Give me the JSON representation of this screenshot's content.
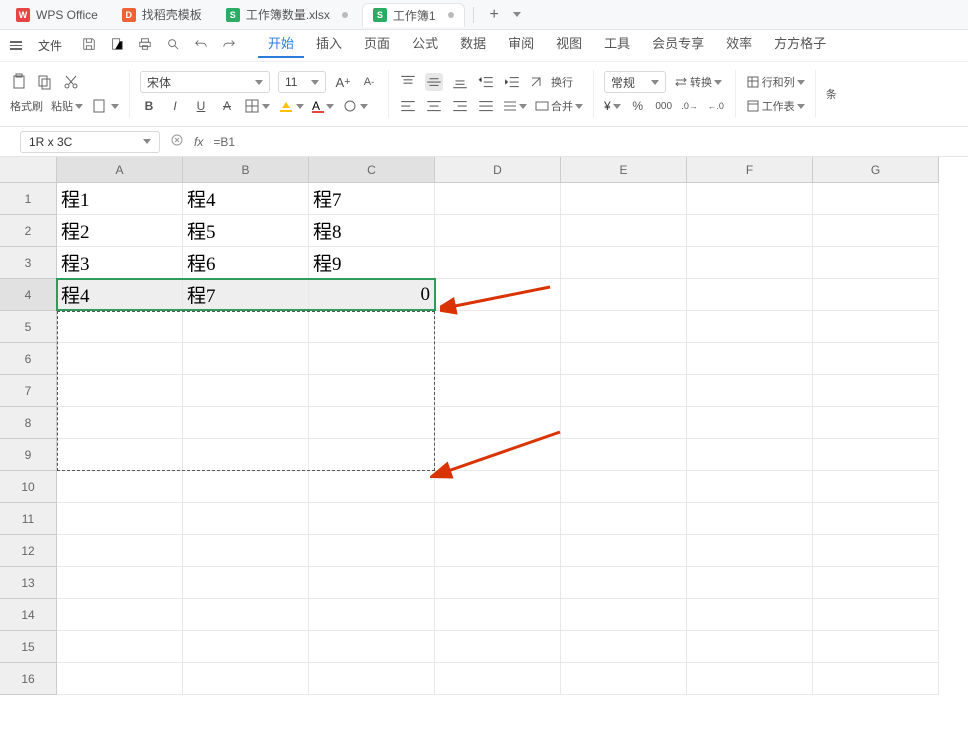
{
  "tabs": [
    {
      "icon": "W",
      "iconClass": "red",
      "label": "WPS Office"
    },
    {
      "icon": "D",
      "iconClass": "orange",
      "label": "找稻壳模板"
    },
    {
      "icon": "S",
      "iconClass": "green",
      "label": "工作簿数量.xlsx",
      "dot": true
    },
    {
      "icon": "S",
      "iconClass": "green",
      "label": "工作簿1",
      "dot": true,
      "active": true
    }
  ],
  "file_label": "文件",
  "menus": [
    "开始",
    "插入",
    "页面",
    "公式",
    "数据",
    "审阅",
    "视图",
    "工具",
    "会员专享",
    "效率",
    "方方格子"
  ],
  "active_menu": 0,
  "clipboard": {
    "format": "格式刷",
    "paste": "粘贴"
  },
  "font": {
    "name": "宋体",
    "size": "11"
  },
  "number": {
    "format": "常规",
    "convert": "转换"
  },
  "layout": {
    "rowscols": "行和列",
    "sheets": "工作表"
  },
  "align": {
    "wrap": "换行",
    "merge": "合并"
  },
  "namebox": "1R x 3C",
  "formula": "=B1",
  "cols": [
    "A",
    "B",
    "C",
    "D",
    "E",
    "F",
    "G"
  ],
  "rows": [
    "1",
    "2",
    "3",
    "4",
    "5",
    "6",
    "7",
    "8",
    "9",
    "10",
    "11",
    "12",
    "13",
    "14",
    "15",
    "16"
  ],
  "data": {
    "r1": [
      "程1",
      "程4",
      "程7"
    ],
    "r2": [
      "程2",
      "程5",
      "程8"
    ],
    "r3": [
      "程3",
      "程6",
      "程9"
    ],
    "r4": [
      "程4",
      "程7",
      "0"
    ]
  },
  "chart_data": {
    "type": "table",
    "columns": [
      "A",
      "B",
      "C"
    ],
    "rows": [
      [
        "程1",
        "程4",
        "程7"
      ],
      [
        "程2",
        "程5",
        "程8"
      ],
      [
        "程3",
        "程6",
        "程9"
      ],
      [
        "程4",
        "程7",
        0
      ]
    ]
  },
  "more_icon": "条"
}
